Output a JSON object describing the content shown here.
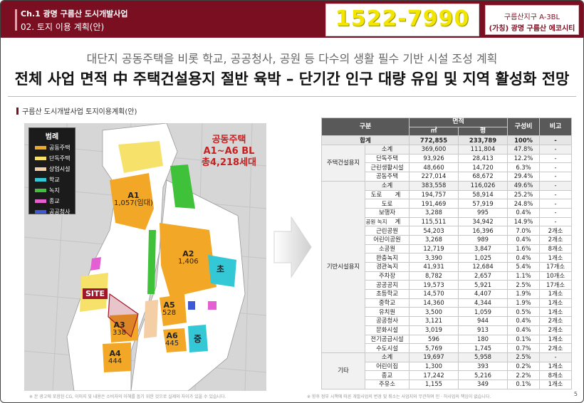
{
  "header": {
    "chapter": "Ch.1 광명 구름산 도시개발사업",
    "section": "02. 토지 이용 계획(안)",
    "phone": "1522-7990",
    "brand_line1": "구름산지구 A-3BL",
    "brand_line2": "(가칭) 광명 구름산 에코시티"
  },
  "subtitle": "대단지 공동주택을 비롯 학교, 공공청사, 공원 등 다수의 생활 필수 기반 시설 조성 계획",
  "headline": "전체 사업 면적 中 주택건설용지 절반 육박 – 단기간 인구 대량 유입 및 지역 활성화 전망",
  "map": {
    "caption": "구름산 도시개발사업 토지이용계획(안)",
    "legend_title": "범례",
    "legend": [
      {
        "label": "공동주택",
        "color": "#f2a826"
      },
      {
        "label": "단독주택",
        "color": "#f6e26b"
      },
      {
        "label": "상업시설",
        "color": "#f4cfa6"
      },
      {
        "label": "학교",
        "color": "#34c7d6"
      },
      {
        "label": "녹지",
        "color": "#3fc13a"
      },
      {
        "label": "종교",
        "color": "#e35fd2"
      },
      {
        "label": "공공청사",
        "color": "#3d5ad6"
      }
    ],
    "note_line1": "공동주택",
    "note_line2": "A1~A6 BL",
    "note_line3": "총4,218세대",
    "zones": [
      {
        "name": "A1",
        "count": "1,057(임대)"
      },
      {
        "name": "A2",
        "count": "1,406"
      },
      {
        "name": "A3",
        "count": "338"
      },
      {
        "name": "A4",
        "count": "444"
      },
      {
        "name": "A5",
        "count": "528"
      },
      {
        "name": "A6",
        "count": "445"
      }
    ],
    "school1": "초",
    "school2": "중",
    "site_label": "SITE"
  },
  "table": {
    "headers": {
      "category": "구분",
      "area": "면적",
      "sqm": "㎡",
      "pyeong": "평",
      "ratio": "구성비",
      "note": "비고"
    },
    "groups": {
      "housing": "주택건설용지",
      "infra": "기반시설용지",
      "road": "도로",
      "park": "공원 녹지",
      "etc": "기타"
    },
    "rows": [
      {
        "label": "합계",
        "sqm": "772,855",
        "py": "233,789",
        "ratio": "100%",
        "note": "-"
      },
      {
        "label": "소계",
        "sqm": "369,600",
        "py": "111,804",
        "ratio": "47.8%",
        "note": "-"
      },
      {
        "label": "단독주택",
        "sqm": "93,926",
        "py": "28,413",
        "ratio": "12.2%",
        "note": "-"
      },
      {
        "label": "근린생활시설",
        "sqm": "48,660",
        "py": "14,720",
        "ratio": "6.3%",
        "note": "-"
      },
      {
        "label": "공동주택",
        "sqm": "227,014",
        "py": "68,672",
        "ratio": "29.4%",
        "note": "-"
      },
      {
        "label": "소계",
        "sqm": "383,558",
        "py": "116,026",
        "ratio": "49.6%",
        "note": "-"
      },
      {
        "label": "계",
        "sqm": "194,757",
        "py": "58,914",
        "ratio": "25.2%",
        "note": "-"
      },
      {
        "label": "도로",
        "sqm": "191,469",
        "py": "57,919",
        "ratio": "24.8%",
        "note": "-"
      },
      {
        "label": "보행자",
        "sqm": "3,288",
        "py": "995",
        "ratio": "0.4%",
        "note": "-"
      },
      {
        "label": "계",
        "sqm": "115,511",
        "py": "34,942",
        "ratio": "14.9%",
        "note": "-"
      },
      {
        "label": "근린공원",
        "sqm": "54,203",
        "py": "16,396",
        "ratio": "7.0%",
        "note": "2개소"
      },
      {
        "label": "어린이공원",
        "sqm": "3,268",
        "py": "989",
        "ratio": "0.4%",
        "note": "2개소"
      },
      {
        "label": "소공원",
        "sqm": "12,719",
        "py": "3,847",
        "ratio": "1.6%",
        "note": "8개소"
      },
      {
        "label": "완충녹지",
        "sqm": "3,390",
        "py": "1,025",
        "ratio": "0.4%",
        "note": "1개소"
      },
      {
        "label": "경관녹지",
        "sqm": "41,931",
        "py": "12,684",
        "ratio": "5.4%",
        "note": "17개소"
      },
      {
        "label": "주차장",
        "sqm": "8,782",
        "py": "2,657",
        "ratio": "1.1%",
        "note": "10개소"
      },
      {
        "label": "공공공지",
        "sqm": "19,573",
        "py": "5,921",
        "ratio": "2.5%",
        "note": "17개소"
      },
      {
        "label": "초등학교",
        "sqm": "14,570",
        "py": "4,407",
        "ratio": "1.9%",
        "note": "1개소"
      },
      {
        "label": "중학교",
        "sqm": "14,360",
        "py": "4,344",
        "ratio": "1.9%",
        "note": "1개소"
      },
      {
        "label": "유치원",
        "sqm": "3,500",
        "py": "1,059",
        "ratio": "0.5%",
        "note": "1개소"
      },
      {
        "label": "공공청사",
        "sqm": "3,121",
        "py": "944",
        "ratio": "0.4%",
        "note": "2개소"
      },
      {
        "label": "문화시설",
        "sqm": "3,019",
        "py": "913",
        "ratio": "0.4%",
        "note": "2개소"
      },
      {
        "label": "전기공급시설",
        "sqm": "596",
        "py": "180",
        "ratio": "0.1%",
        "note": "1개소"
      },
      {
        "label": "수도시설",
        "sqm": "5,769",
        "py": "1,745",
        "ratio": "0.7%",
        "note": "2개소"
      },
      {
        "label": "소계",
        "sqm": "19,697",
        "py": "5,958",
        "ratio": "2.5%",
        "note": "-"
      },
      {
        "label": "어린이집",
        "sqm": "1,300",
        "py": "393",
        "ratio": "0.2%",
        "note": "1개소"
      },
      {
        "label": "종교",
        "sqm": "17,242",
        "py": "5,216",
        "ratio": "2.2%",
        "note": "8개소"
      },
      {
        "label": "주유소",
        "sqm": "1,155",
        "py": "349",
        "ratio": "0.1%",
        "note": "1개소"
      }
    ]
  },
  "footer_left": "※ 본 광고에 포함된 CG, 이미지 및 내용은 소비자의 이해를 돕기 위한 것으로 실제와 차이가 있을 수 있습니다.",
  "footer_right": "※ 향후 정부 시책에 따른 개발사업의 변경 및 취소는 사업지와 무관하며 인 · 허사업의 책임이 없습니다.",
  "page_number": "5"
}
